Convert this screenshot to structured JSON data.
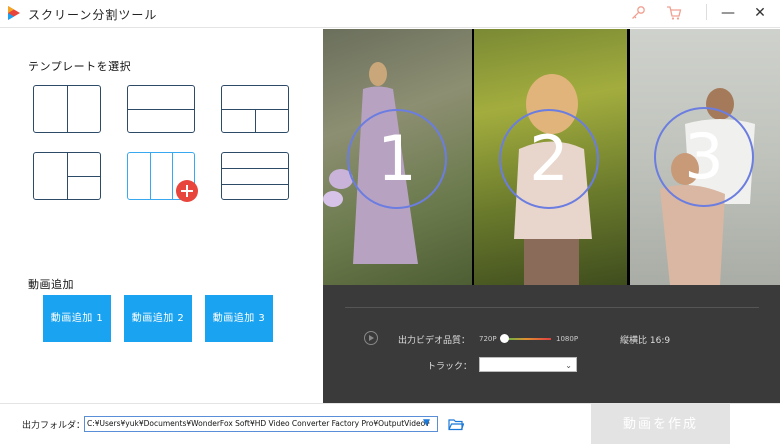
{
  "app": {
    "title": "スクリーン分割ツール"
  },
  "window": {
    "minimize": "—",
    "close": "✕"
  },
  "left": {
    "template_heading": "テンプレートを選択",
    "add_heading": "動画追加",
    "add_buttons": [
      "動画追加 1",
      "動画追加 2",
      "動画追加 3"
    ]
  },
  "preview": {
    "panes": [
      "1",
      "2",
      "3"
    ]
  },
  "controls": {
    "quality_label": "出力ビデオ品質：",
    "quality_min": "720P",
    "quality_max": "1080P",
    "aspect_label": "縦横比 16:9",
    "track_label": "トラック：",
    "track_value": ""
  },
  "bottom": {
    "folder_label": "出力フォルダ：",
    "folder_path": "C:¥Users¥yuk¥Documents¥WonderFox Soft¥HD Video Converter Factory Pro¥OutputVideo¥",
    "create_button": "動画を作成"
  },
  "colors": {
    "accent": "#1aa3f0",
    "badge": "#e8453c",
    "dark_panel": "#3a3a3a"
  }
}
